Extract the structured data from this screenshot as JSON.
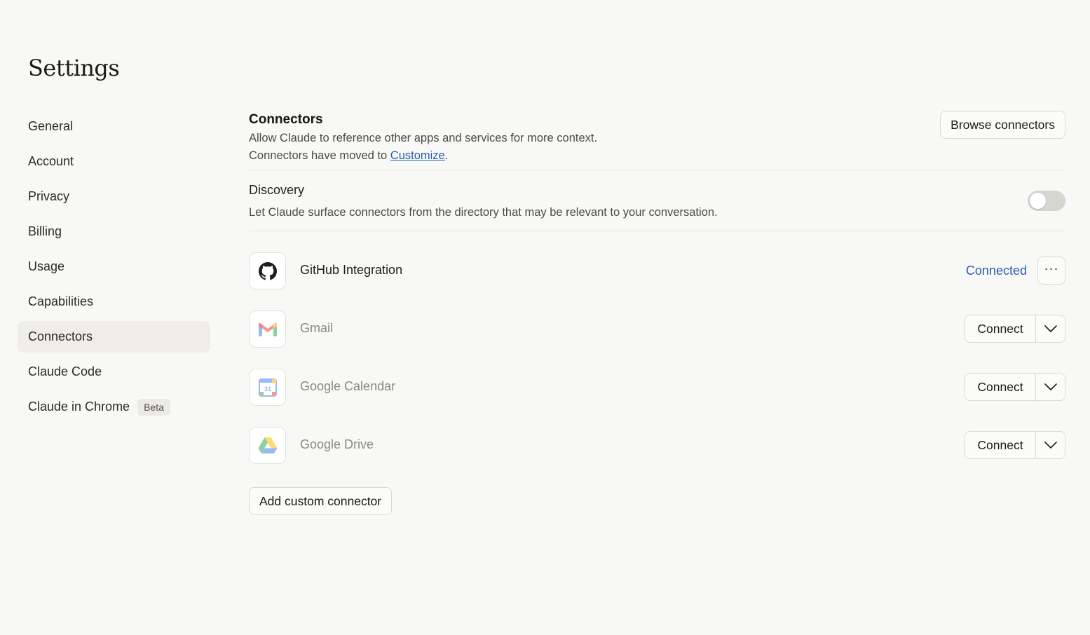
{
  "page": {
    "title": "Settings"
  },
  "sidebar": {
    "items": [
      {
        "label": "General"
      },
      {
        "label": "Account"
      },
      {
        "label": "Privacy"
      },
      {
        "label": "Billing"
      },
      {
        "label": "Usage"
      },
      {
        "label": "Capabilities"
      },
      {
        "label": "Connectors",
        "active": true
      },
      {
        "label": "Claude Code"
      },
      {
        "label": "Claude in Chrome",
        "badge": "Beta"
      }
    ]
  },
  "connectors_section": {
    "title": "Connectors",
    "description": "Allow Claude to reference other apps and services for more context.",
    "moved_prefix": "Connectors have moved to ",
    "moved_link": "Customize",
    "moved_suffix": ".",
    "browse_label": "Browse connectors"
  },
  "discovery": {
    "title": "Discovery",
    "description": "Let Claude surface connectors from the directory that may be relevant to your conversation.",
    "enabled": false
  },
  "connectors": [
    {
      "name": "GitHub Integration",
      "icon": "github-icon",
      "status": "Connected",
      "more_label": "···"
    },
    {
      "name": "Gmail",
      "icon": "gmail-icon",
      "action": "Connect"
    },
    {
      "name": "Google Calendar",
      "icon": "google-calendar-icon",
      "action": "Connect",
      "icon_text": "31"
    },
    {
      "name": "Google Drive",
      "icon": "google-drive-icon",
      "action": "Connect"
    }
  ],
  "add_custom_label": "Add custom connector",
  "colors": {
    "accent_link": "#2a5db0",
    "active_nav_bg": "#eeede9",
    "page_bg": "#f8f8f6"
  }
}
